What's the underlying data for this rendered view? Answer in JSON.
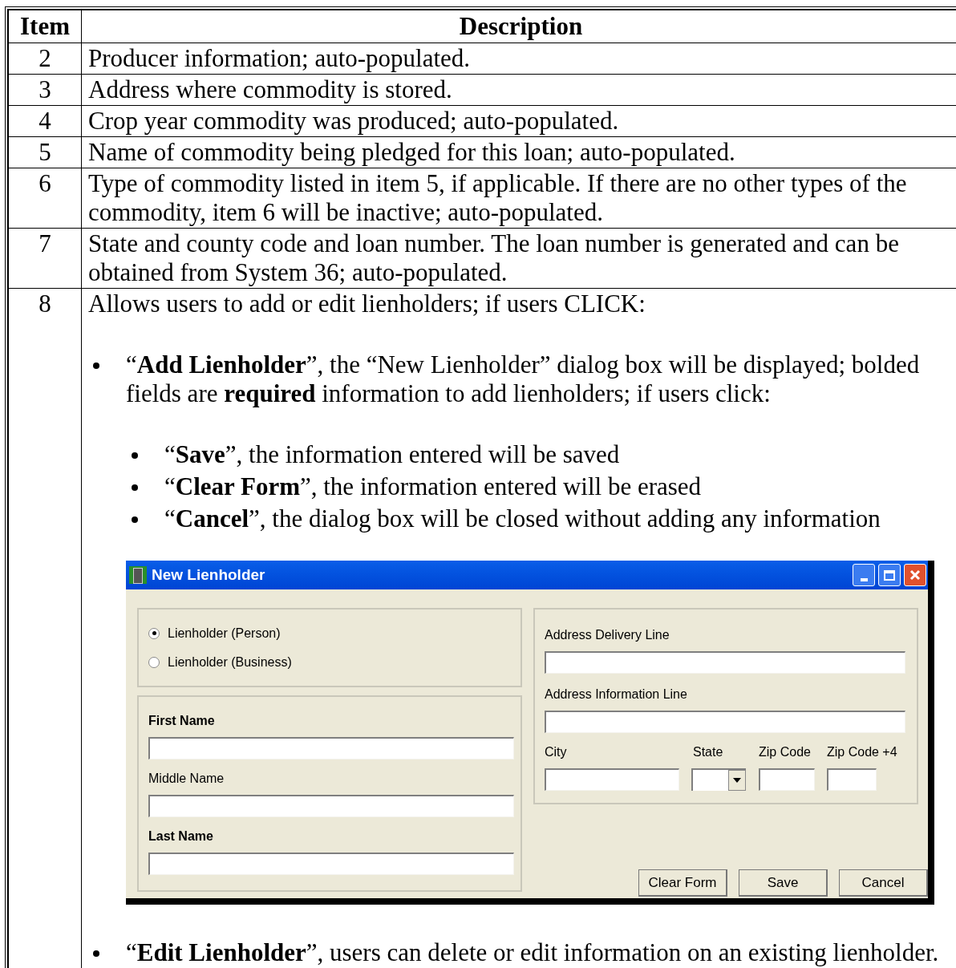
{
  "table": {
    "columns": [
      "Item",
      "Description"
    ],
    "rows": [
      {
        "kind": "text",
        "item": "2",
        "description": "Producer information; auto-populated."
      },
      {
        "kind": "text",
        "item": "3",
        "description": "Address where commodity is stored."
      },
      {
        "kind": "text",
        "item": "4",
        "description": "Crop year commodity was produced; auto-populated."
      },
      {
        "kind": "text",
        "item": "5",
        "description": "Name of commodity being pledged for this loan; auto-populated."
      },
      {
        "kind": "text",
        "item": "6",
        "description": "Type of commodity listed in item 5, if applicable.  If there are no other types of the commodity, item 6 will be inactive; auto-populated."
      },
      {
        "kind": "text",
        "item": "7",
        "description": "State and county code and loan number.  The loan number is generated and can be obtained from System 36; auto-populated."
      },
      {
        "kind": "detail",
        "item": "8",
        "intro": "Allows users to add or edit lienholders; if users CLICK:",
        "bullets": [
          {
            "text": "“**Add Lienholder**”, the “New Lienholder” dialog box will be displayed; bolded fields are **required** information to add lienholders; if users click:",
            "sub_bullets": [
              "“**Save**”, the information entered will be saved",
              "“**Clear Form**”, the information entered will be erased",
              "“**Cancel**”, the dialog box will be closed without adding any information"
            ],
            "dialog": {
              "title": "New Lienholder",
              "radios": [
                {
                  "label": "Lienholder (Person)",
                  "selected": true
                },
                {
                  "label": "Lienholder (Business)",
                  "selected": false
                }
              ],
              "name_fields": [
                {
                  "label": "First Name",
                  "required": true
                },
                {
                  "label": "Middle Name",
                  "required": false
                },
                {
                  "label": "Last Name",
                  "required": true
                }
              ],
              "address_fields": [
                {
                  "label": "Address Delivery Line"
                },
                {
                  "label": "Address Information Line"
                }
              ],
              "location_fields": [
                {
                  "label": "City",
                  "kind": "text"
                },
                {
                  "label": "State",
                  "kind": "dropdown"
                },
                {
                  "label": "Zip Code",
                  "kind": "text"
                },
                {
                  "label": "Zip Code +4",
                  "kind": "text"
                }
              ],
              "buttons": [
                "Clear Form",
                "Save",
                "Cancel"
              ]
            }
          },
          {
            "text": "“**Edit Lienholder**”, users can delete or edit information on an existing lienholder."
          }
        ]
      }
    ]
  }
}
